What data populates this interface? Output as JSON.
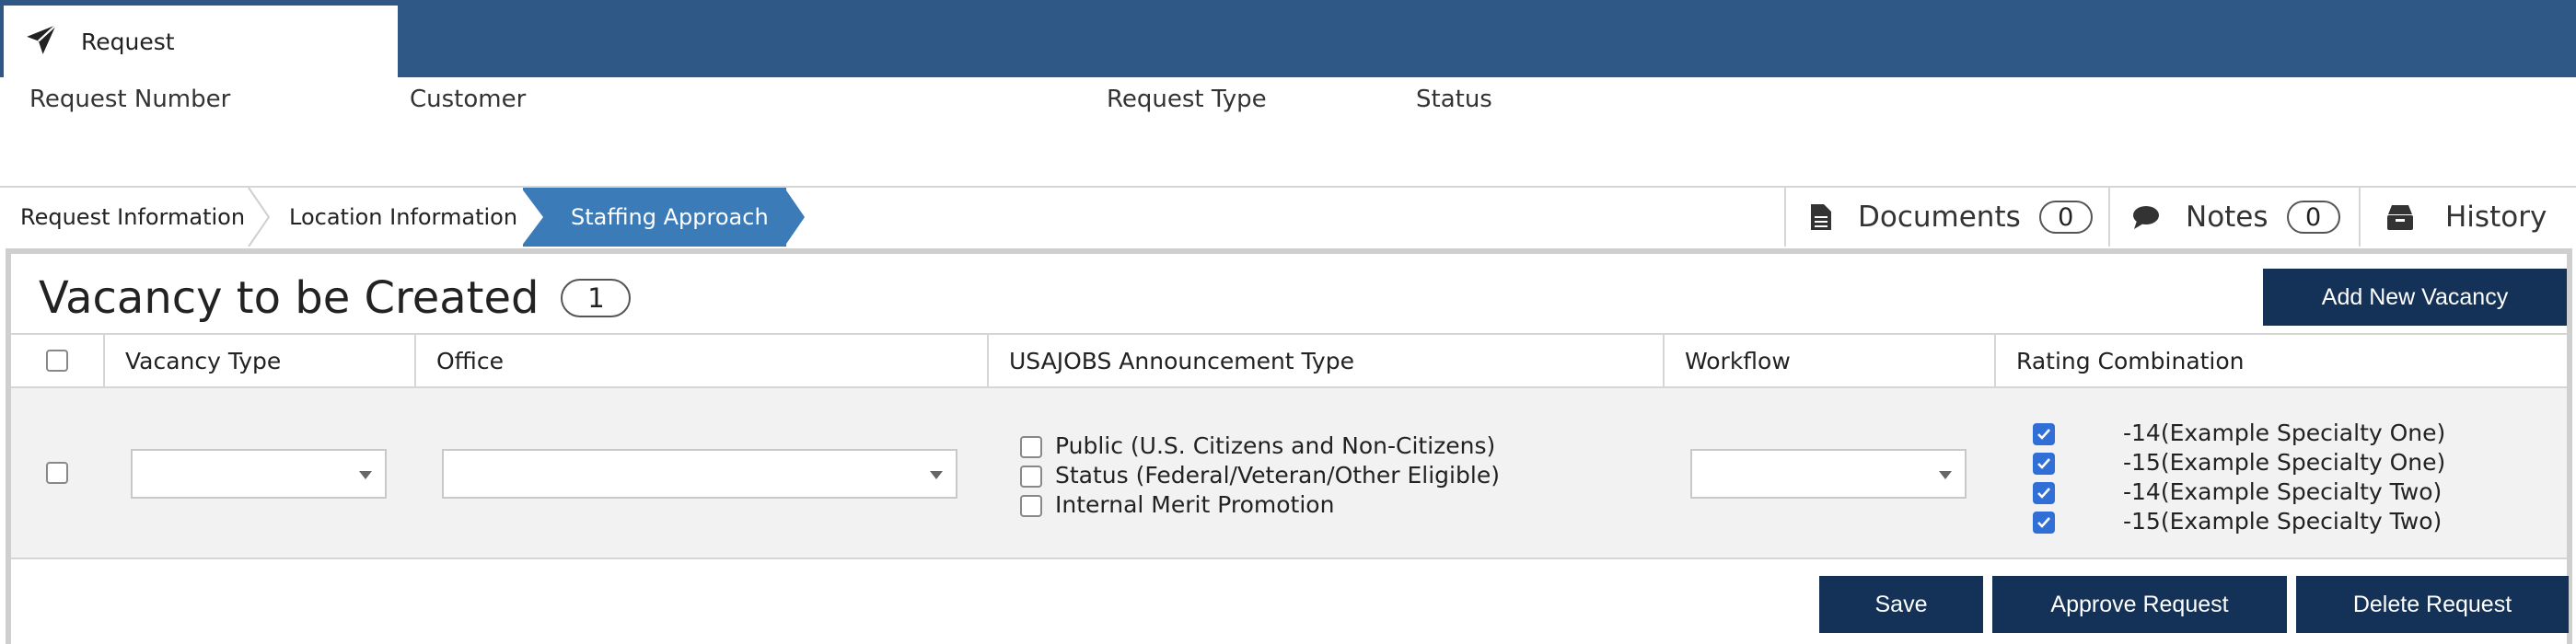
{
  "top_tab": {
    "label": "Request",
    "icon": "paper-plane-icon"
  },
  "header_fields": {
    "request_number": "Request Number",
    "customer": "Customer",
    "request_type": "Request Type",
    "status": "Status"
  },
  "steps": [
    {
      "label": "Request Information",
      "active": false
    },
    {
      "label": "Location Information",
      "active": false
    },
    {
      "label": "Staffing Approach",
      "active": true
    }
  ],
  "tools": {
    "documents": {
      "label": "Documents",
      "count": "0",
      "icon": "document-icon"
    },
    "notes": {
      "label": "Notes",
      "count": "0",
      "icon": "comment-icon"
    },
    "history": {
      "label": "History",
      "icon": "archive-icon"
    }
  },
  "panel": {
    "title": "Vacancy to be Created",
    "count": "1",
    "add_button": "Add New Vacancy"
  },
  "table": {
    "columns": [
      "Vacancy Type",
      "Office",
      "USAJOBS Announcement Type",
      "Workflow",
      "Rating Combination"
    ],
    "row": {
      "vacancy_type": "",
      "office": "",
      "workflow": "",
      "announcement_types": [
        {
          "label": "Public (U.S. Citizens and Non-Citizens)",
          "checked": false
        },
        {
          "label": "Status (Federal/Veteran/Other Eligible)",
          "checked": false
        },
        {
          "label": "Internal Merit Promotion",
          "checked": false
        }
      ],
      "rating_combinations": [
        {
          "label": "-14(Example Specialty One)",
          "checked": true
        },
        {
          "label": "-15(Example Specialty One)",
          "checked": true
        },
        {
          "label": "-14(Example Specialty Two)",
          "checked": true
        },
        {
          "label": "-15(Example Specialty Two)",
          "checked": true
        }
      ]
    }
  },
  "actions": {
    "save": "Save",
    "approve": "Approve Request",
    "delete": "Delete Request"
  },
  "colors": {
    "topbar": "#2f5886",
    "step_active": "#3b7bb8",
    "button": "#143257",
    "checkbox_on": "#2f6fd6"
  }
}
